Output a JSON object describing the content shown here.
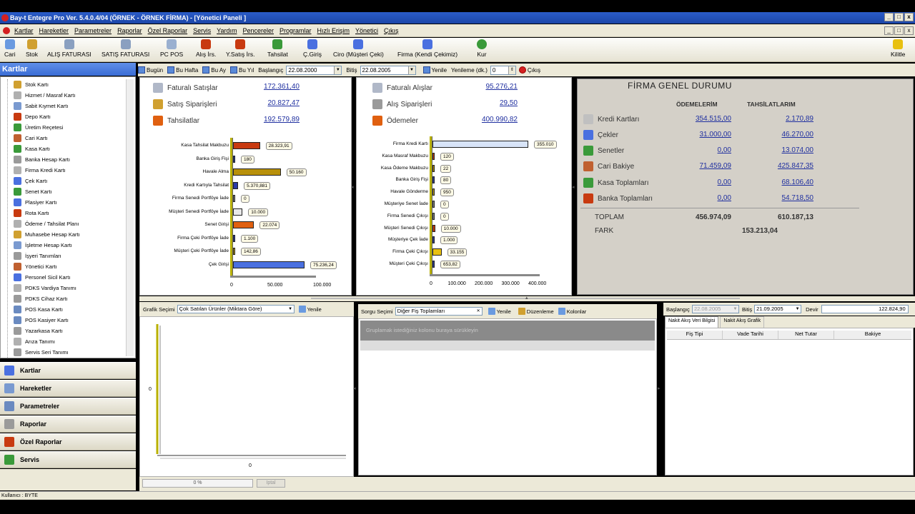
{
  "title": "Bay-t Entegre Pro Ver. 5.4.0.4/04 (ÖRNEK - ÖRNEK FİRMA) - [Yönetici Paneli ]",
  "menu": [
    "Kartlar",
    "Hareketler",
    "Parametreler",
    "Raporlar",
    "Özel Raporlar",
    "Servis",
    "Yardım",
    "Pencereler",
    "Programlar",
    "Hızlı Erişim",
    "Yönetici",
    "Çıkış"
  ],
  "toolbar": [
    "Cari",
    "Stok",
    "ALIŞ FATURASI",
    "SATIŞ FATURASI",
    "PC POS",
    "Alış İrs.",
    "Y.Satış İrs.",
    "Tahsilat",
    "Ç.Giriş",
    "Ciro (Müşteri Çeki)",
    "Firma (Kendi Çekimiz)",
    "Kur",
    "Kilitle"
  ],
  "sidebar": {
    "header": "Kartlar",
    "items": [
      "Stok Kartı",
      "Hizmet / Masraf Kartı",
      "Sabit Kıymet Kartı",
      "Depo Kartı",
      "Üretim Reçetesi",
      "Cari Kartı",
      "Kasa Kartı",
      "Banka Hesap Kartı",
      "Firma Kredi Kartı",
      "Çek Kartı",
      "Senet Kartı",
      "Plasiyer Kartı",
      "Rota Kartı",
      "Ödeme / Tahsilat Planı",
      "Muhasebe Hesap Kartı",
      "İşletme Hesap Kartı",
      "İşyeri Tanımları",
      "Yönetici Kartı",
      "Personel Sicil Kartı",
      "PDKS Vardiya Tanımı",
      "PDKS Cihaz Kartı",
      "POS Kasa Kartı",
      "POS Kasiyer Kartı",
      "Yazarkasa Kartı",
      "Arıza Tanımı",
      "Servis Seri Tanımı"
    ],
    "nav": [
      "Kartlar",
      "Hareketler",
      "Parametreler",
      "Raporlar",
      "Özel Raporlar",
      "Servis"
    ]
  },
  "filter": {
    "today": "Bugün",
    "week": "Bu Hafta",
    "month": "Bu Ay",
    "year": "Bu Yıl",
    "start_label": "Başlangıç",
    "start": "22.08.2000",
    "end_label": "Bitiş",
    "end": "22.08.2005",
    "refresh": "Yenile",
    "refresh_label": "Yenileme (dk.)",
    "refresh_val": "0",
    "exit": "Çıkış"
  },
  "sales": {
    "rows": [
      {
        "label": "Faturalı Satışlar",
        "value": "172.361,40"
      },
      {
        "label": "Satış Siparişleri",
        "value": "20.827,47"
      },
      {
        "label": "Tahsilatlar",
        "value": "192.579,89"
      }
    ],
    "bars": [
      {
        "label": "Kasa Tahsilat Makbuzu",
        "value": 28323.91,
        "text": "28.323,91",
        "color": "#c83a10"
      },
      {
        "label": "Banka Giriş Fişi",
        "value": 180,
        "text": "180",
        "color": "#223a9a"
      },
      {
        "label": "Havale Alma",
        "value": 50160,
        "text": "50.160",
        "color": "#b8900a"
      },
      {
        "label": "Kredi Kartıyla Tahsilat",
        "value": 5370.881,
        "text": "5.370,881",
        "color": "#2a3aa8"
      },
      {
        "label": "Firma Senedi Portföye İade",
        "value": 0,
        "text": "0",
        "color": "#888"
      },
      {
        "label": "Müşteri Senedi Portföye İade",
        "value": 10000,
        "text": "10.000",
        "color": "#e8e8e8"
      },
      {
        "label": "Senet Girişi",
        "value": 22074,
        "text": "22.074",
        "color": "#e06010"
      },
      {
        "label": "Firma Çeki Portföye İade",
        "value": 1100,
        "text": "1.100",
        "color": "#2a3aa8"
      },
      {
        "label": "Müşteri Çeki Portföye İade",
        "value": 142.86,
        "text": "142,86",
        "color": "#c0a020"
      },
      {
        "label": "Çek Girişi",
        "value": 75236.24,
        "text": "75.236,24",
        "color": "#4a70e0"
      }
    ],
    "ticks": [
      "0",
      "50.000",
      "100.000"
    ]
  },
  "purchases": {
    "rows": [
      {
        "label": "Faturalı Alışlar",
        "value": "95.276,21"
      },
      {
        "label": "Alış Siparişleri",
        "value": "29,50"
      },
      {
        "label": "Ödemeler",
        "value": "400.990,82"
      }
    ],
    "bars": [
      {
        "label": "Firma Kredi Kartı",
        "value": 355010,
        "text": "355.010",
        "color": "#d8e4f8"
      },
      {
        "label": "Kasa Masraf Makbuzu",
        "value": 120,
        "text": "120",
        "color": "#c83a10"
      },
      {
        "label": "Kasa Ödeme Makbuzu",
        "value": 22,
        "text": "22",
        "color": "#b8900a"
      },
      {
        "label": "Banka Giriş Fişi",
        "value": 80,
        "text": "80",
        "color": "#2a3aa8"
      },
      {
        "label": "Havale Gönderme",
        "value": 950,
        "text": "950",
        "color": "#c0a020"
      },
      {
        "label": "Müşteriye Senet İade",
        "value": 0,
        "text": "0",
        "color": "#888"
      },
      {
        "label": "Firma Senedi Çıkışı",
        "value": 0,
        "text": "0",
        "color": "#888"
      },
      {
        "label": "Müşteri Senedi Çıkışı",
        "value": 10000,
        "text": "10.000",
        "color": "#c83a10"
      },
      {
        "label": "Müşteriye Çek İade",
        "value": 1000,
        "text": "1.000",
        "color": "#2a3aa8"
      },
      {
        "label": "Firma Çeki Çıkışı",
        "value": 33155,
        "text": "33.155",
        "color": "#e8c010"
      },
      {
        "label": "Müşteri Çeki Çıkışı",
        "value": 653.82,
        "text": "653,82",
        "color": "#2a3aa8"
      }
    ],
    "ticks": [
      "0",
      "100.000",
      "200.000",
      "300.000",
      "400.000"
    ]
  },
  "firma": {
    "title": "FİRMA GENEL DURUMU",
    "col1": "ÖDEMELERİM",
    "col2": "TAHSİLATLARIM",
    "rows": [
      {
        "label": "Kredi Kartları",
        "a": "354.515,00",
        "b": "2.170,89"
      },
      {
        "label": "Çekler",
        "a": "31.000,00",
        "b": "46.270,00"
      },
      {
        "label": "Senetler",
        "a": "0,00",
        "b": "13.074,00"
      },
      {
        "label": "Cari Bakiye",
        "a": "71.459,09",
        "b": "425.847,35"
      },
      {
        "label": "Kasa Toplamları",
        "a": "0,00",
        "b": "68.106,40"
      },
      {
        "label": "Banka Toplamları",
        "a": "0,00",
        "b": "54.718,50"
      }
    ],
    "total_label": "TOPLAM",
    "total_a": "456.974,09",
    "total_b": "610.187,13",
    "diff_label": "FARK",
    "diff": "153.213,04"
  },
  "graph": {
    "label": "Grafik Seçimi",
    "select": "Çok Satılan Ürünler (Miktara Göre)",
    "refresh": "Yenile",
    "zero_y": "0",
    "zero_x": "0"
  },
  "query": {
    "label": "Sorgu Seçimi",
    "select": "Diğer Fiş Toplamları",
    "refresh": "Yenile",
    "edit": "Düzenleme",
    "cols": "Kolonlar",
    "group_hint": "Gruplamak istediğiniz kolonu buraya sürükleyin"
  },
  "cash": {
    "start_label": "Başlangıç",
    "start": "22.08.2005",
    "end_label": "Bitiş",
    "end": "21.09.2005",
    "carry_label": "Devir",
    "carry": "122.824,90",
    "tabs": [
      "Nakit Akış Veri Bilgisi",
      "Nakit Akış Grafik"
    ],
    "cols": [
      "Fiş Tipi",
      "Vade Tarihi",
      "Net Tutar",
      "Bakiye"
    ]
  },
  "progress": {
    "text": "0 %",
    "btn": "Iptal",
    "value": 0
  },
  "status": "Kullanıcı : BYTE"
}
